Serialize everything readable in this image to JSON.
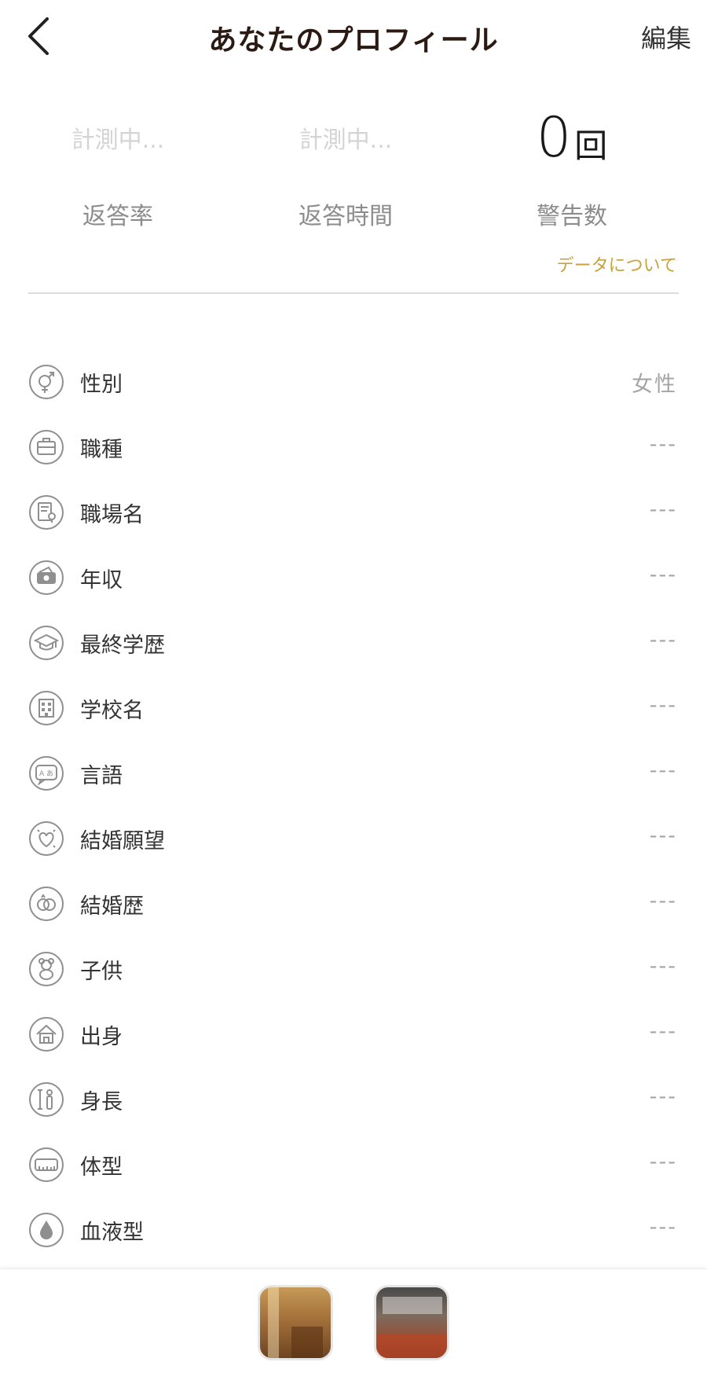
{
  "header": {
    "title": "あなたのプロフィール",
    "edit_label": "編集"
  },
  "stats": [
    {
      "value": "計測中...",
      "label": "返答率"
    },
    {
      "value": "計測中...",
      "label": "返答時間"
    },
    {
      "value": "0",
      "unit": "回",
      "label": "警告数"
    }
  ],
  "data_link": "データについて",
  "profile": [
    {
      "label": "性別",
      "value": "女性",
      "icon": "gender-icon"
    },
    {
      "label": "職種",
      "value": "---",
      "icon": "briefcase-icon"
    },
    {
      "label": "職場名",
      "value": "---",
      "icon": "workplace-icon"
    },
    {
      "label": "年収",
      "value": "---",
      "icon": "wallet-icon"
    },
    {
      "label": "最終学歴",
      "value": "---",
      "icon": "graduation-cap-icon"
    },
    {
      "label": "学校名",
      "value": "---",
      "icon": "school-building-icon"
    },
    {
      "label": "言語",
      "value": "---",
      "icon": "language-icon"
    },
    {
      "label": "結婚願望",
      "value": "---",
      "icon": "heart-icon"
    },
    {
      "label": "結婚歴",
      "value": "---",
      "icon": "rings-icon"
    },
    {
      "label": "子供",
      "value": "---",
      "icon": "teddy-bear-icon"
    },
    {
      "label": "出身",
      "value": "---",
      "icon": "house-icon"
    },
    {
      "label": "身長",
      "value": "---",
      "icon": "height-icon"
    },
    {
      "label": "体型",
      "value": "---",
      "icon": "tape-measure-icon"
    },
    {
      "label": "血液型",
      "value": "---",
      "icon": "blood-drop-icon"
    }
  ],
  "colors": {
    "accent": "#c9a23c",
    "title": "#2b1a12",
    "icon": "#8f8f8f"
  }
}
